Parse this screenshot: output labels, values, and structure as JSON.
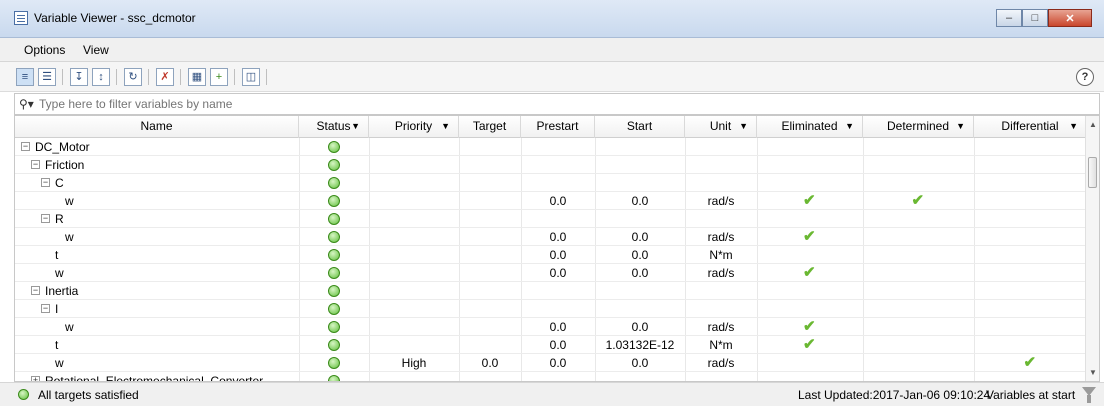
{
  "window": {
    "title": "Variable Viewer - ssc_dcmotor"
  },
  "menu": [
    "Options",
    "View"
  ],
  "toolbar": {
    "help": "?"
  },
  "filter": {
    "placeholder": "Type here to filter variables by name"
  },
  "columns": [
    "Name",
    "Status",
    "Priority",
    "Target",
    "Prestart",
    "Start",
    "Unit",
    "Eliminated",
    "Determined",
    "Differential"
  ],
  "rows": [
    {
      "name": "DC_Motor",
      "depth": 0,
      "toggle": "-",
      "status": "ok",
      "priority": "",
      "target": "",
      "prestart": "",
      "start": "",
      "unit": "",
      "eliminated": false,
      "determined": false,
      "differential": false
    },
    {
      "name": "Friction",
      "depth": 1,
      "toggle": "-",
      "status": "ok",
      "priority": "",
      "target": "",
      "prestart": "",
      "start": "",
      "unit": "",
      "eliminated": false,
      "determined": false,
      "differential": false
    },
    {
      "name": "C",
      "depth": 2,
      "toggle": "-",
      "status": "ok",
      "priority": "",
      "target": "",
      "prestart": "",
      "start": "",
      "unit": "",
      "eliminated": false,
      "determined": false,
      "differential": false
    },
    {
      "name": "w",
      "depth": 3,
      "toggle": "",
      "status": "ok",
      "priority": "",
      "target": "",
      "prestart": "0.0",
      "start": "0.0",
      "unit": "rad/s",
      "eliminated": true,
      "determined": true,
      "differential": false
    },
    {
      "name": "R",
      "depth": 2,
      "toggle": "-",
      "status": "ok",
      "priority": "",
      "target": "",
      "prestart": "",
      "start": "",
      "unit": "",
      "eliminated": false,
      "determined": false,
      "differential": false
    },
    {
      "name": "w",
      "depth": 3,
      "toggle": "",
      "status": "ok",
      "priority": "",
      "target": "",
      "prestart": "0.0",
      "start": "0.0",
      "unit": "rad/s",
      "eliminated": true,
      "determined": false,
      "differential": false
    },
    {
      "name": "t",
      "depth": 2,
      "toggle": "",
      "status": "ok",
      "priority": "",
      "target": "",
      "prestart": "0.0",
      "start": "0.0",
      "unit": "N*m",
      "eliminated": false,
      "determined": false,
      "differential": false
    },
    {
      "name": "w",
      "depth": 2,
      "toggle": "",
      "status": "ok",
      "priority": "",
      "target": "",
      "prestart": "0.0",
      "start": "0.0",
      "unit": "rad/s",
      "eliminated": true,
      "determined": false,
      "differential": false
    },
    {
      "name": "Inertia",
      "depth": 1,
      "toggle": "-",
      "status": "ok",
      "priority": "",
      "target": "",
      "prestart": "",
      "start": "",
      "unit": "",
      "eliminated": false,
      "determined": false,
      "differential": false
    },
    {
      "name": "I",
      "depth": 2,
      "toggle": "-",
      "status": "ok",
      "priority": "",
      "target": "",
      "prestart": "",
      "start": "",
      "unit": "",
      "eliminated": false,
      "determined": false,
      "differential": false
    },
    {
      "name": "w",
      "depth": 3,
      "toggle": "",
      "status": "ok",
      "priority": "",
      "target": "",
      "prestart": "0.0",
      "start": "0.0",
      "unit": "rad/s",
      "eliminated": true,
      "determined": false,
      "differential": false
    },
    {
      "name": "t",
      "depth": 2,
      "toggle": "",
      "status": "ok",
      "priority": "",
      "target": "",
      "prestart": "0.0",
      "start": "1.03132E-12",
      "unit": "N*m",
      "eliminated": true,
      "determined": false,
      "differential": false
    },
    {
      "name": "w",
      "depth": 2,
      "toggle": "",
      "status": "ok",
      "priority": "High",
      "target": "0.0",
      "prestart": "0.0",
      "start": "0.0",
      "unit": "rad/s",
      "eliminated": false,
      "determined": false,
      "differential": true
    },
    {
      "name": "Rotational_Electromechanical_Converter",
      "depth": 1,
      "toggle": "+",
      "status": "ok",
      "priority": "",
      "target": "",
      "prestart": "",
      "start": "",
      "unit": "",
      "eliminated": false,
      "determined": false,
      "differential": false
    }
  ],
  "statusbar": {
    "message": "All targets satisfied",
    "updated": "Last Updated:2017-Jan-06 09:10:24",
    "mode": "Variables at start"
  },
  "colors": {
    "ok": "#5fbf3a",
    "check": "#6ab832",
    "titlebar": "#c9d9ee"
  }
}
